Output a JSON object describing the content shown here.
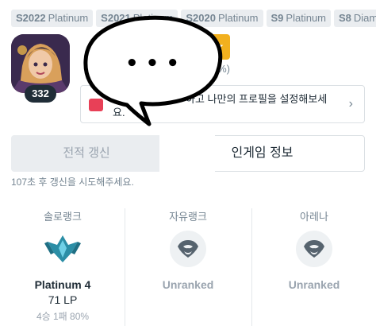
{
  "seasons": [
    {
      "season": "S2022",
      "tier": "Platinum"
    },
    {
      "season": "S2021",
      "tier": "Platinum"
    },
    {
      "season": "S2020",
      "tier": "Platinum"
    },
    {
      "season": "S9",
      "tier": "Platinum"
    },
    {
      "season": "S8",
      "tier": "Diam"
    }
  ],
  "profile": {
    "level": "332",
    "percent_text": ".38%)"
  },
  "notice": {
    "text": "하고 나만의 프로필을 설정해보세요.",
    "text_line1": "하고 나만의 프로필을 설정해보세",
    "text_line2": "요.",
    "chevron": "›"
  },
  "bubble": {
    "text": "• • •"
  },
  "buttons": {
    "refresh_label": "전적 갱신",
    "ingame_label": "인게임 정보"
  },
  "retry_text": "107초 후 갱신을 시도해주세요.",
  "ranks": [
    {
      "queue": "솔로랭크",
      "tier": "Platinum 4",
      "lp": "71 LP",
      "record": "4승 1패 80%",
      "emblem": "platinum-emblem-icon"
    },
    {
      "queue": "자유랭크",
      "tier": "Unranked",
      "lp": "",
      "record": "",
      "emblem": "unranked-emblem-icon"
    },
    {
      "queue": "아레나",
      "tier": "Unranked",
      "lp": "",
      "record": "",
      "emblem": "unranked-emblem-icon"
    }
  ],
  "colors": {
    "tier_gold": "#f2b01e",
    "accent_red": "#e84057",
    "platinum_teal": "#2b8ea6"
  }
}
